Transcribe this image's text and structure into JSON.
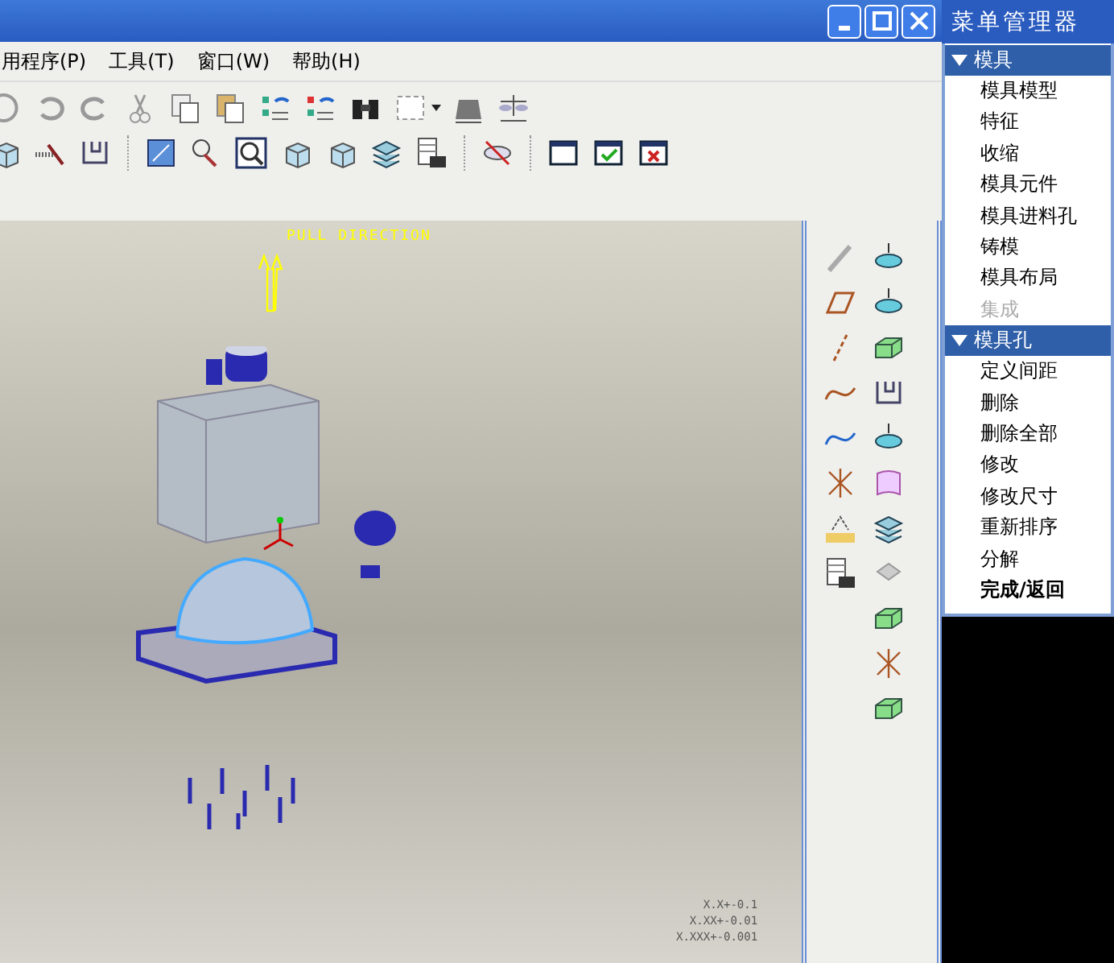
{
  "menu_bar": [
    {
      "label": "用程序(P)"
    },
    {
      "label": "工具(T)"
    },
    {
      "label": "窗口(W)"
    },
    {
      "label": "帮助(H)"
    }
  ],
  "viewport": {
    "pull_label": "PULL DIRECTION",
    "tolerances": [
      "X.X+-0.1",
      "X.XX+-0.01",
      "X.XXX+-0.001"
    ]
  },
  "menu_manager": {
    "title": "菜单管理器",
    "sections": [
      {
        "title": "模具",
        "expanded": true,
        "items": [
          {
            "label": "模具模型",
            "disabled": false,
            "default": false
          },
          {
            "label": "特征",
            "disabled": false,
            "default": false
          },
          {
            "label": "收缩",
            "disabled": false,
            "default": false
          },
          {
            "label": "模具元件",
            "disabled": false,
            "default": false
          },
          {
            "label": "模具进料孔",
            "disabled": false,
            "default": false
          },
          {
            "label": "铸模",
            "disabled": false,
            "default": false
          },
          {
            "label": "模具布局",
            "disabled": false,
            "default": false
          },
          {
            "label": "集成",
            "disabled": true,
            "default": false
          }
        ]
      },
      {
        "title": "模具孔",
        "expanded": true,
        "items": [
          {
            "label": "定义间距",
            "disabled": false,
            "default": false
          },
          {
            "label": "删除",
            "disabled": false,
            "default": false
          },
          {
            "label": "删除全部",
            "disabled": false,
            "default": false
          },
          {
            "label": "修改",
            "disabled": false,
            "default": false
          },
          {
            "label": "修改尺寸",
            "disabled": false,
            "default": false
          },
          {
            "label": "重新排序",
            "disabled": false,
            "default": false
          },
          {
            "label": "分解",
            "disabled": false,
            "default": false
          },
          {
            "label": "完成/返回",
            "disabled": false,
            "default": true
          }
        ]
      }
    ]
  }
}
